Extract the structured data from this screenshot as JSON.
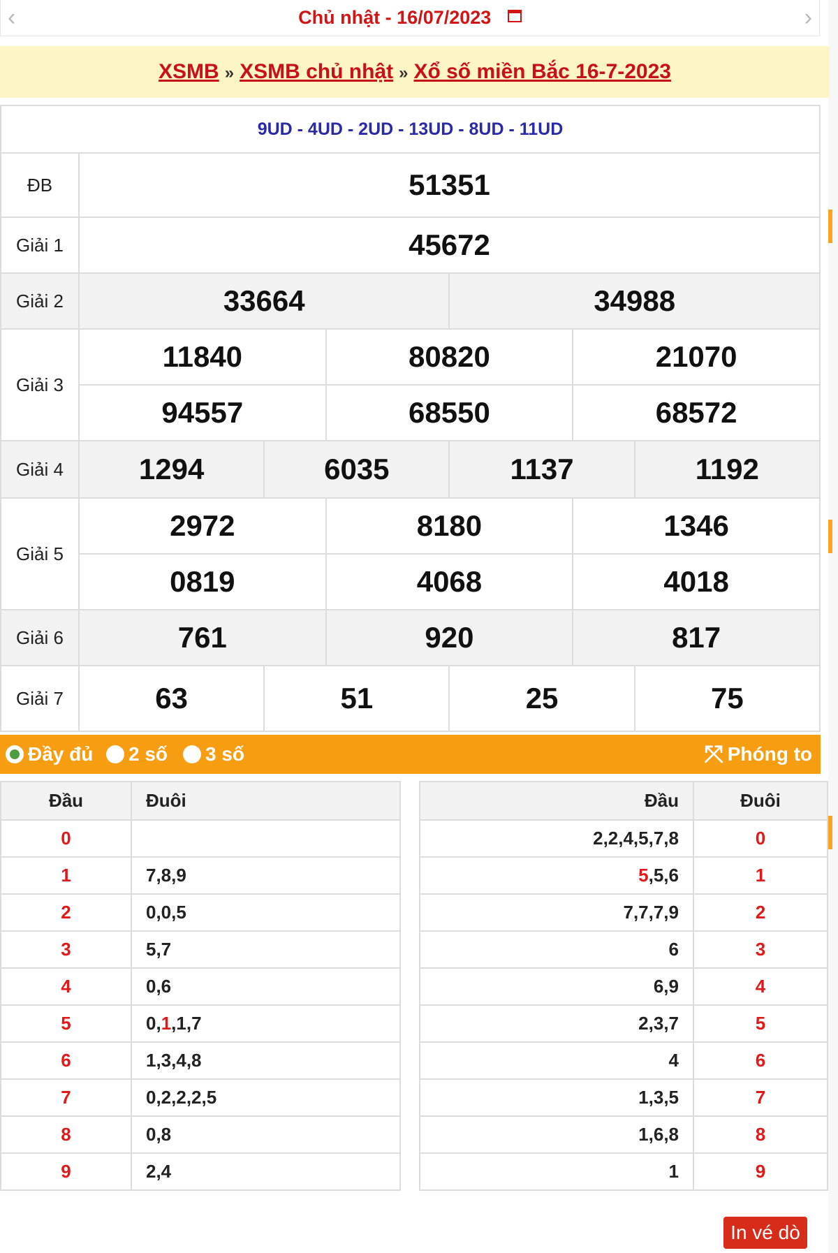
{
  "date_nav": {
    "prefix": "Chủ nhật - ",
    "date": "16/07/2023",
    "prev_icon": "chevron-left-icon",
    "next_icon": "chevron-right-icon"
  },
  "breadcrumb": {
    "items": [
      "XSMB",
      "XSMB chủ nhật",
      "Xổ số miền Bắc 16-7-2023"
    ],
    "separator": "»"
  },
  "codes": "9UD - 4UD - 2UD - 13UD - 8UD - 11UD",
  "prizes": {
    "db": {
      "label": "ĐB",
      "values": [
        "51351"
      ]
    },
    "g1": {
      "label": "Giải 1",
      "values": [
        "45672"
      ]
    },
    "g2": {
      "label": "Giải 2",
      "values": [
        "33664",
        "34988"
      ]
    },
    "g3": {
      "label": "Giải 3",
      "values": [
        "11840",
        "80820",
        "21070",
        "94557",
        "68550",
        "68572"
      ]
    },
    "g4": {
      "label": "Giải 4",
      "values": [
        "1294",
        "6035",
        "1137",
        "1192"
      ]
    },
    "g5": {
      "label": "Giải 5",
      "values": [
        "2972",
        "8180",
        "1346",
        "0819",
        "4068",
        "4018"
      ]
    },
    "g6": {
      "label": "Giải 6",
      "values": [
        "761",
        "920",
        "817"
      ]
    },
    "g7": {
      "label": "Giải 7",
      "values": [
        "63",
        "51",
        "25",
        "75"
      ]
    }
  },
  "options": {
    "full": "Đầy đủ",
    "two": "2 số",
    "three": "3 số",
    "zoom": "Phóng to",
    "selected": "full"
  },
  "loto_head": {
    "headers": [
      "Đầu",
      "Đuôi"
    ],
    "rows": [
      {
        "h": "0",
        "t": ""
      },
      {
        "h": "1",
        "t": "7,8,9"
      },
      {
        "h": "2",
        "t": "0,0,5"
      },
      {
        "h": "3",
        "t": "5,7"
      },
      {
        "h": "4",
        "t": "0,6"
      },
      {
        "h": "5",
        "t_pre": "0,",
        "t_red": "1",
        "t_post": ",1,7"
      },
      {
        "h": "6",
        "t": "1,3,4,8"
      },
      {
        "h": "7",
        "t": "0,2,2,2,5"
      },
      {
        "h": "8",
        "t": "0,8"
      },
      {
        "h": "9",
        "t": "2,4"
      }
    ]
  },
  "loto_tail": {
    "headers": [
      "Đầu",
      "Đuôi"
    ],
    "rows": [
      {
        "h": "2,2,4,5,7,8",
        "t": "0"
      },
      {
        "h_red": "5",
        "h_post": ",5,6",
        "t": "1"
      },
      {
        "h": "7,7,7,9",
        "t": "2"
      },
      {
        "h": "6",
        "t": "3"
      },
      {
        "h": "6,9",
        "t": "4"
      },
      {
        "h": "2,3,7",
        "t": "5"
      },
      {
        "h": "4",
        "t": "6"
      },
      {
        "h": "1,3,5",
        "t": "7"
      },
      {
        "h": "1,6,8",
        "t": "8"
      },
      {
        "h": "1",
        "t": "9"
      }
    ]
  },
  "print_button": "In vé dò",
  "colors": {
    "red": "#e01919",
    "orange": "#f79d12",
    "breadcrumb_bg": "#fef5c6",
    "code_blue": "#2a2aa8",
    "green": "#4c9e3d"
  }
}
